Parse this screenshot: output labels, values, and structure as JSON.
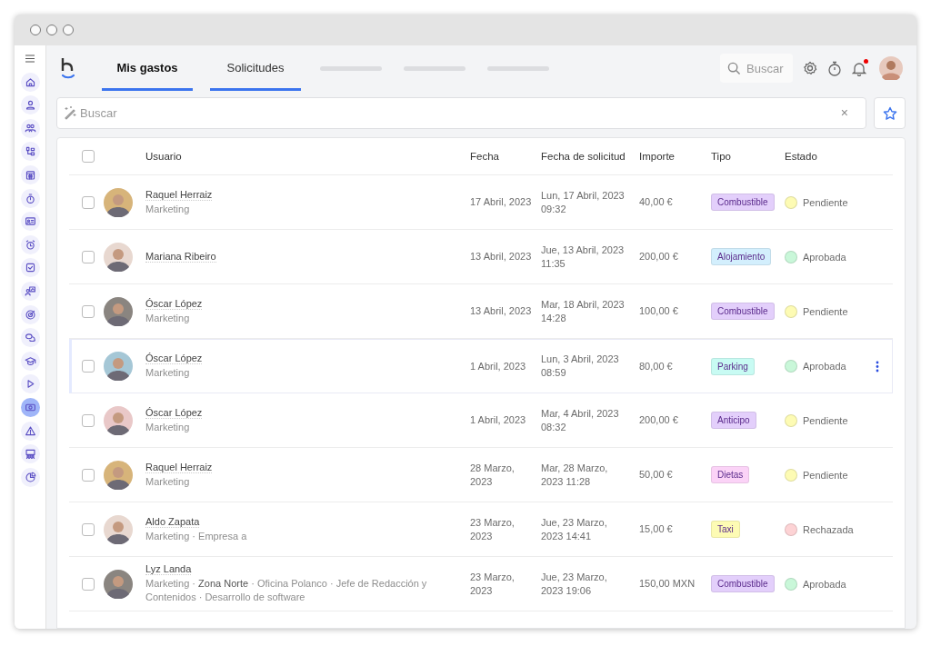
{
  "sidebar": {
    "items": [
      {
        "selected": false
      },
      {
        "selected": false
      },
      {
        "selected": false
      },
      {
        "selected": false
      },
      {
        "selected": false
      },
      {
        "selected": false
      },
      {
        "selected": false
      },
      {
        "selected": false
      },
      {
        "selected": false
      },
      {
        "selected": false
      },
      {
        "selected": false
      },
      {
        "selected": false
      },
      {
        "selected": false
      },
      {
        "selected": false
      },
      {
        "selected": true
      },
      {
        "selected": false
      },
      {
        "selected": false
      },
      {
        "selected": false
      }
    ]
  },
  "tabs": [
    {
      "label": "Mis gastos",
      "selected": true
    },
    {
      "label": "Solicitudes",
      "selected": false
    }
  ],
  "top_search": {
    "placeholder": "Buscar"
  },
  "notifications": {
    "unread": true
  },
  "search": {
    "placeholder": "Buscar",
    "clear": "×"
  },
  "table": {
    "select_all": {
      "checked": false
    },
    "columns": [
      "Usuario",
      "Fecha",
      "Fecha de solicitud",
      "Importe",
      "Tipo",
      "Estado"
    ],
    "rows": [
      {
        "name": "Raquel Herraiz",
        "detail": "Marketing",
        "date": "17 Abril, 2023",
        "requested": "Lun, 17 Abril, 2023 09:32",
        "amount": "40,00 €",
        "type": {
          "label": "Combustible",
          "color": "#e3cffb"
        },
        "status": {
          "label": "Pendiente",
          "color": "#fdfbb4"
        },
        "highlighted": false,
        "checked": false
      },
      {
        "name": "Mariana Ribeiro",
        "date": "13 Abril, 2023",
        "requested": "Jue, 13 Abril, 2023 11:35",
        "amount": "200,00 €",
        "type": {
          "label": "Alojamiento",
          "color": "#d3effd"
        },
        "status": {
          "label": "Aprobada",
          "color": "#c9f7d9"
        },
        "highlighted": false,
        "checked": false
      },
      {
        "name": "Óscar López",
        "detail": "Marketing",
        "date": "13 Abril, 2023",
        "requested": "Mar, 18 Abril, 2023 14:28",
        "amount": "100,00 €",
        "type": {
          "label": "Combustible",
          "color": "#e3cffb"
        },
        "status": {
          "label": "Pendiente",
          "color": "#fdfbb4"
        },
        "highlighted": false,
        "checked": false
      },
      {
        "name": "Óscar López",
        "detail": "Marketing",
        "date": "1 Abril, 2023",
        "requested": "Lun, 3 Abril, 2023 08:59",
        "amount": "80,00 €",
        "type": {
          "label": "Parking",
          "color": "#c8fbf3"
        },
        "status": {
          "label": "Aprobada",
          "color": "#c9f7d9"
        },
        "highlighted": true,
        "checked": false
      },
      {
        "name": "Óscar López",
        "detail": "Marketing",
        "date": "1 Abril, 2023",
        "requested": "Mar, 4 Abril, 2023 08:32",
        "amount": "200,00 €",
        "type": {
          "label": "Anticipo",
          "color": "#e3cffb"
        },
        "status": {
          "label": "Pendiente",
          "color": "#fdfbb4"
        },
        "highlighted": false,
        "checked": false
      },
      {
        "name": "Raquel Herraiz",
        "detail": "Marketing",
        "date": "28 Marzo, 2023",
        "requested": "Mar, 28 Marzo, 2023 11:28",
        "amount": "50,00 €",
        "type": {
          "label": "Dietas",
          "color": "#fbd3f7"
        },
        "status": {
          "label": "Pendiente",
          "color": "#fdfbb4"
        },
        "highlighted": false,
        "checked": false
      },
      {
        "name": "Aldo Zapata",
        "detail": "Marketing · Empresa a",
        "date": "23 Marzo, 2023",
        "requested": "Jue, 23 Marzo, 2023 14:41",
        "amount": "15,00 €",
        "type": {
          "label": "Taxi",
          "color": "#fdfbb4"
        },
        "status": {
          "label": "Rechazada",
          "color": "#fdd3d5"
        },
        "highlighted": false,
        "checked": false
      },
      {
        "name": "Lyz Landa",
        "detail": "Marketing · **Zona Norte** · Oficina Polanco · Jefe de Redacción y Contenidos · Desarrollo de software",
        "date": "23 Marzo, 2023",
        "requested": "Jue, 23 Marzo, 2023 19:06",
        "amount": "150,00 MXN",
        "type": {
          "label": "Combustible",
          "color": "#e3cffb"
        },
        "status": {
          "label": "Aprobada",
          "color": "#c9f7d9"
        },
        "highlighted": false,
        "checked": false
      }
    ]
  }
}
